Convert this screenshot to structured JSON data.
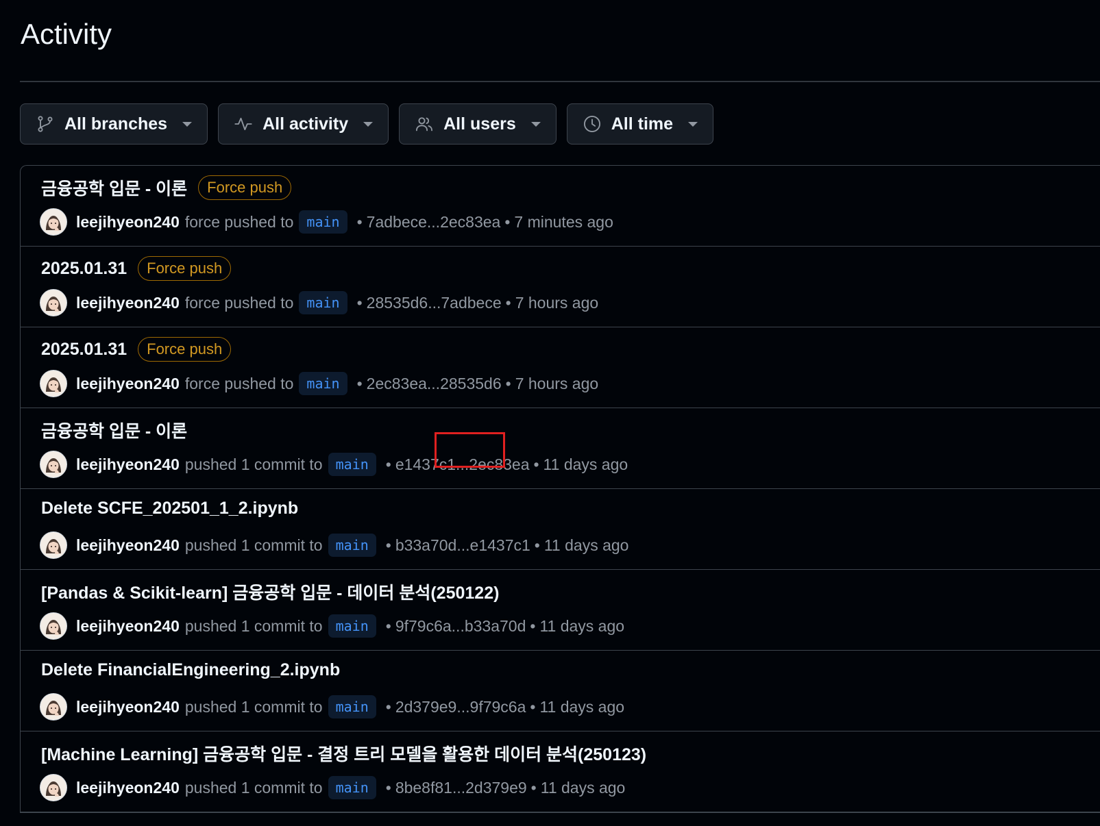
{
  "page": {
    "title": "Activity"
  },
  "filters": [
    {
      "label": "All branches",
      "icon": "git-branch-icon"
    },
    {
      "label": "All activity",
      "icon": "pulse-icon"
    },
    {
      "label": "All users",
      "icon": "people-icon"
    },
    {
      "label": "All time",
      "icon": "clock-icon"
    }
  ],
  "items": [
    {
      "title": "금융공학 입문 - 이론",
      "badge": "Force push",
      "user": "leejihyeon240",
      "action": "force pushed to",
      "branch": "main",
      "range": "7adbece...2ec83ea",
      "time": "7 minutes ago"
    },
    {
      "title": "2025.01.31",
      "badge": "Force push",
      "user": "leejihyeon240",
      "action": "force pushed to",
      "branch": "main",
      "range": "28535d6...7adbece",
      "time": "7 hours ago"
    },
    {
      "title": "2025.01.31",
      "badge": "Force push",
      "user": "leejihyeon240",
      "action": "force pushed to",
      "branch": "main",
      "range": "2ec83ea...28535d6",
      "time": "7 hours ago"
    },
    {
      "title": "금융공학 입문 - 이론",
      "badge": "",
      "user": "leejihyeon240",
      "action": "pushed 1 commit to",
      "branch": "main",
      "range": "e1437c1...2ec83ea",
      "time": "11 days ago"
    },
    {
      "title": "Delete SCFE_202501_1_2.ipynb",
      "badge": "",
      "user": "leejihyeon240",
      "action": "pushed 1 commit to",
      "branch": "main",
      "range": "b33a70d...e1437c1",
      "time": "11 days ago"
    },
    {
      "title": "[Pandas & Scikit-learn] 금융공학 입문 - 데이터 분석(250122)",
      "badge": "",
      "user": "leejihyeon240",
      "action": "pushed 1 commit to",
      "branch": "main",
      "range": "9f79c6a...b33a70d",
      "time": "11 days ago"
    },
    {
      "title": "Delete FinancialEngineering_2.ipynb",
      "badge": "",
      "user": "leejihyeon240",
      "action": "pushed 1 commit to",
      "branch": "main",
      "range": "2d379e9...9f79c6a",
      "time": "11 days ago"
    },
    {
      "title": "[Machine Learning] 금융공학 입문 - 결정 트리 모델을 활용한 데이터 분석(250123)",
      "badge": "",
      "user": "leejihyeon240",
      "action": "pushed 1 commit to",
      "branch": "main",
      "range": "8be8f81...2d379e9",
      "time": "11 days ago"
    }
  ],
  "colors": {
    "background": "#010409",
    "border": "#3d444d",
    "badge": "#d29922",
    "branch_text": "#4493f8",
    "highlight": "#e02020"
  }
}
